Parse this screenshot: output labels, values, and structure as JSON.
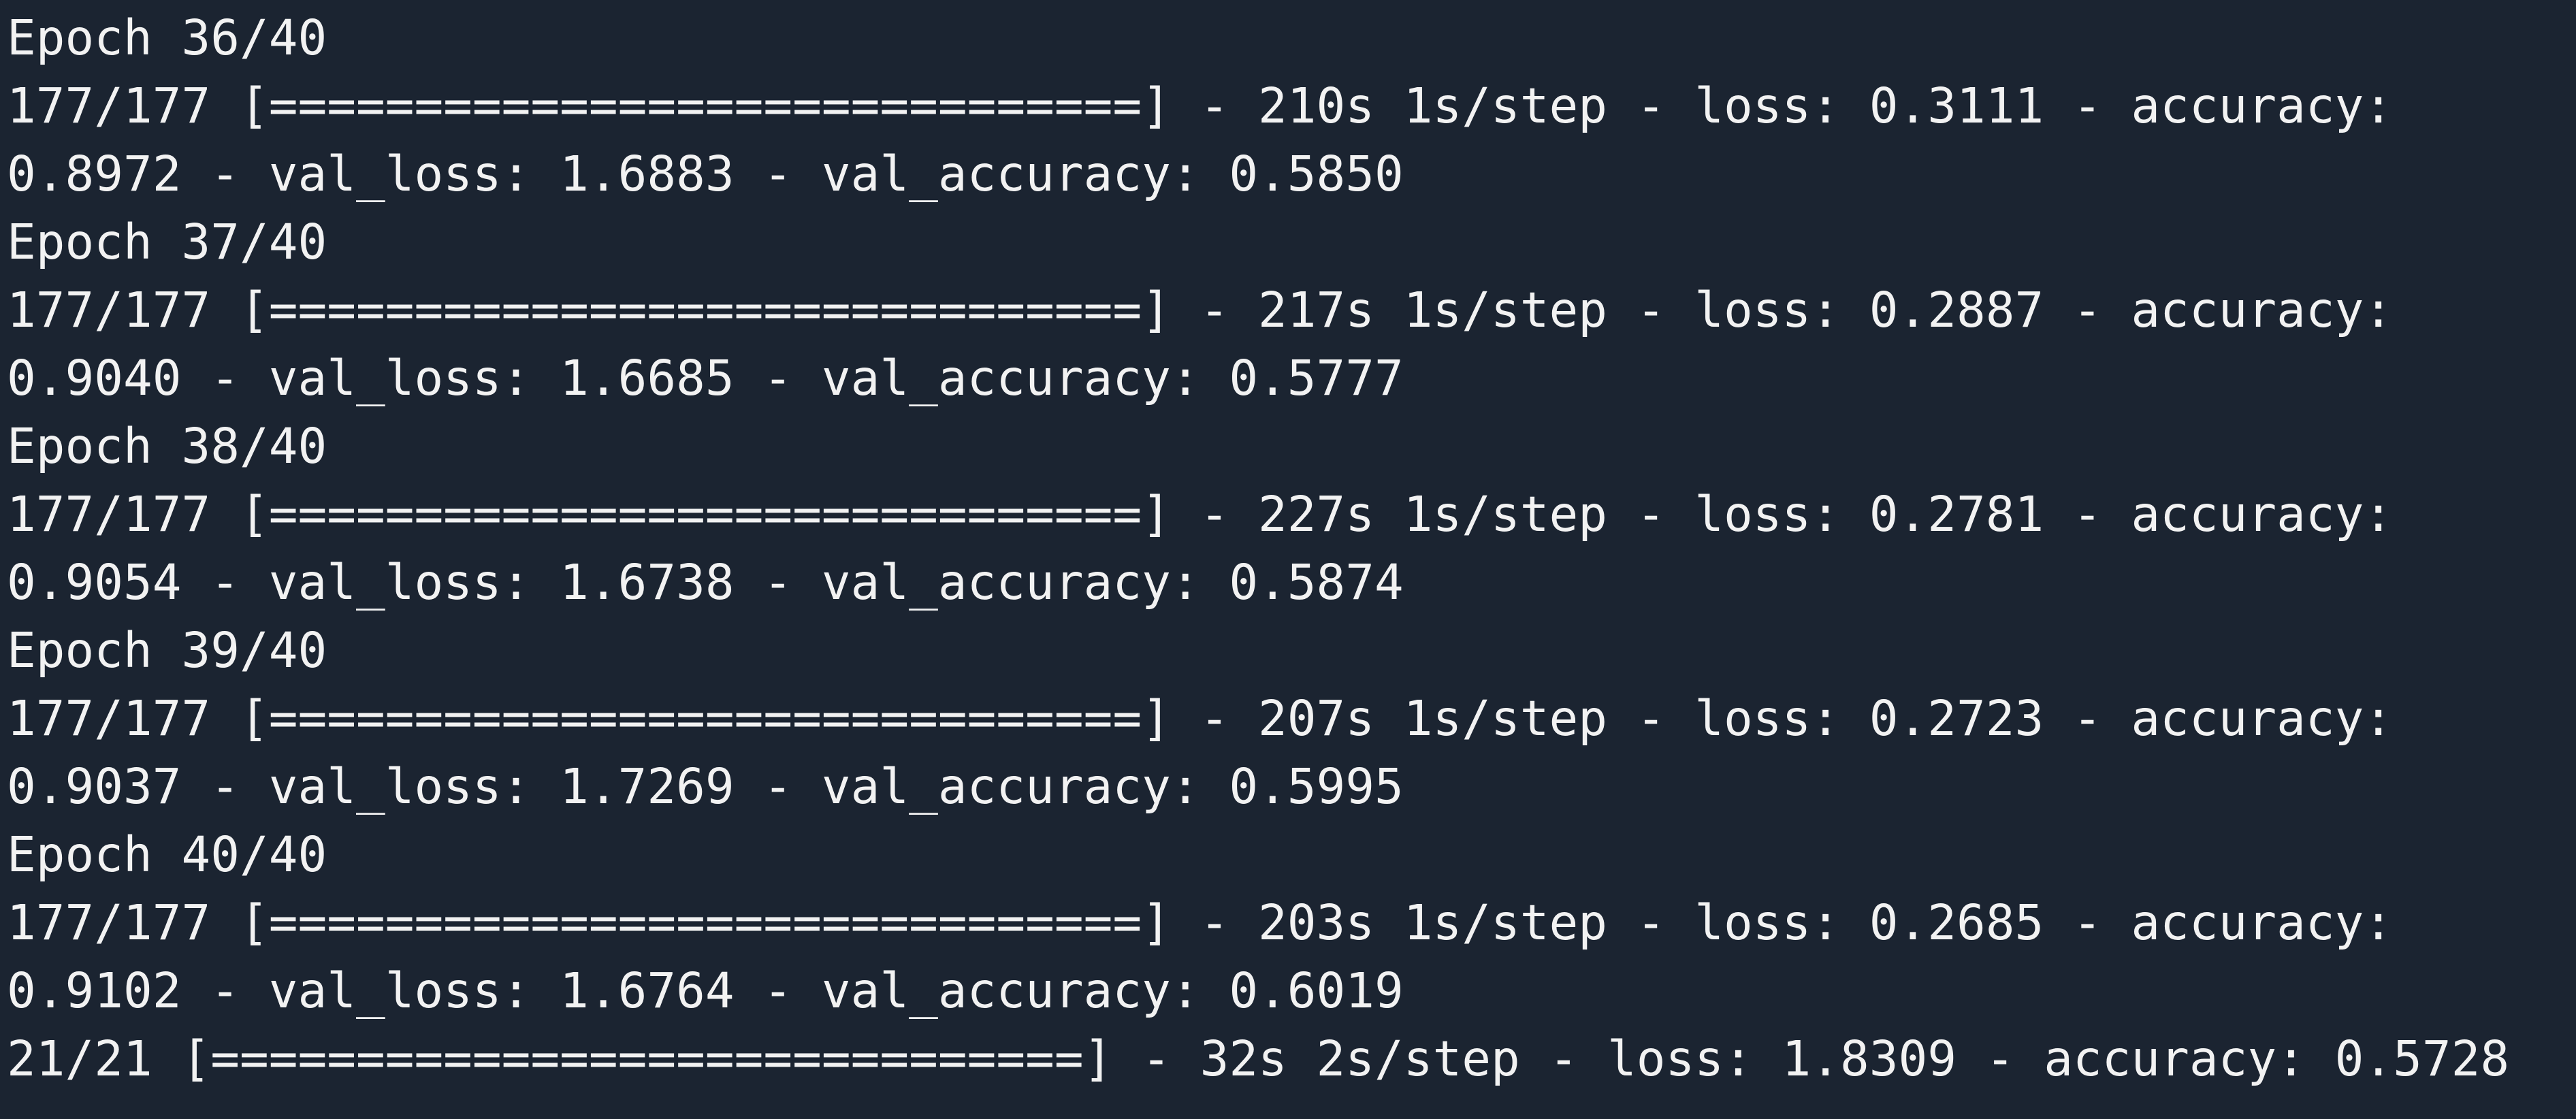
{
  "terminal": {
    "lines": [
      "Epoch 36/40",
      "177/177 [==============================] - 210s 1s/step - loss: 0.3111 - accuracy:",
      "0.8972 - val_loss: 1.6883 - val_accuracy: 0.5850",
      "Epoch 37/40",
      "177/177 [==============================] - 217s 1s/step - loss: 0.2887 - accuracy:",
      "0.9040 - val_loss: 1.6685 - val_accuracy: 0.5777",
      "Epoch 38/40",
      "177/177 [==============================] - 227s 1s/step - loss: 0.2781 - accuracy:",
      "0.9054 - val_loss: 1.6738 - val_accuracy: 0.5874",
      "Epoch 39/40",
      "177/177 [==============================] - 207s 1s/step - loss: 0.2723 - accuracy:",
      "0.9037 - val_loss: 1.7269 - val_accuracy: 0.5995",
      "Epoch 40/40",
      "177/177 [==============================] - 203s 1s/step - loss: 0.2685 - accuracy:",
      "0.9102 - val_loss: 1.6764 - val_accuracy: 0.6019",
      "21/21 [==============================] - 32s 2s/step - loss: 1.8309 - accuracy: 0.5728"
    ]
  },
  "colors": {
    "background": "#1b2431",
    "text": "#f2f2f2"
  }
}
